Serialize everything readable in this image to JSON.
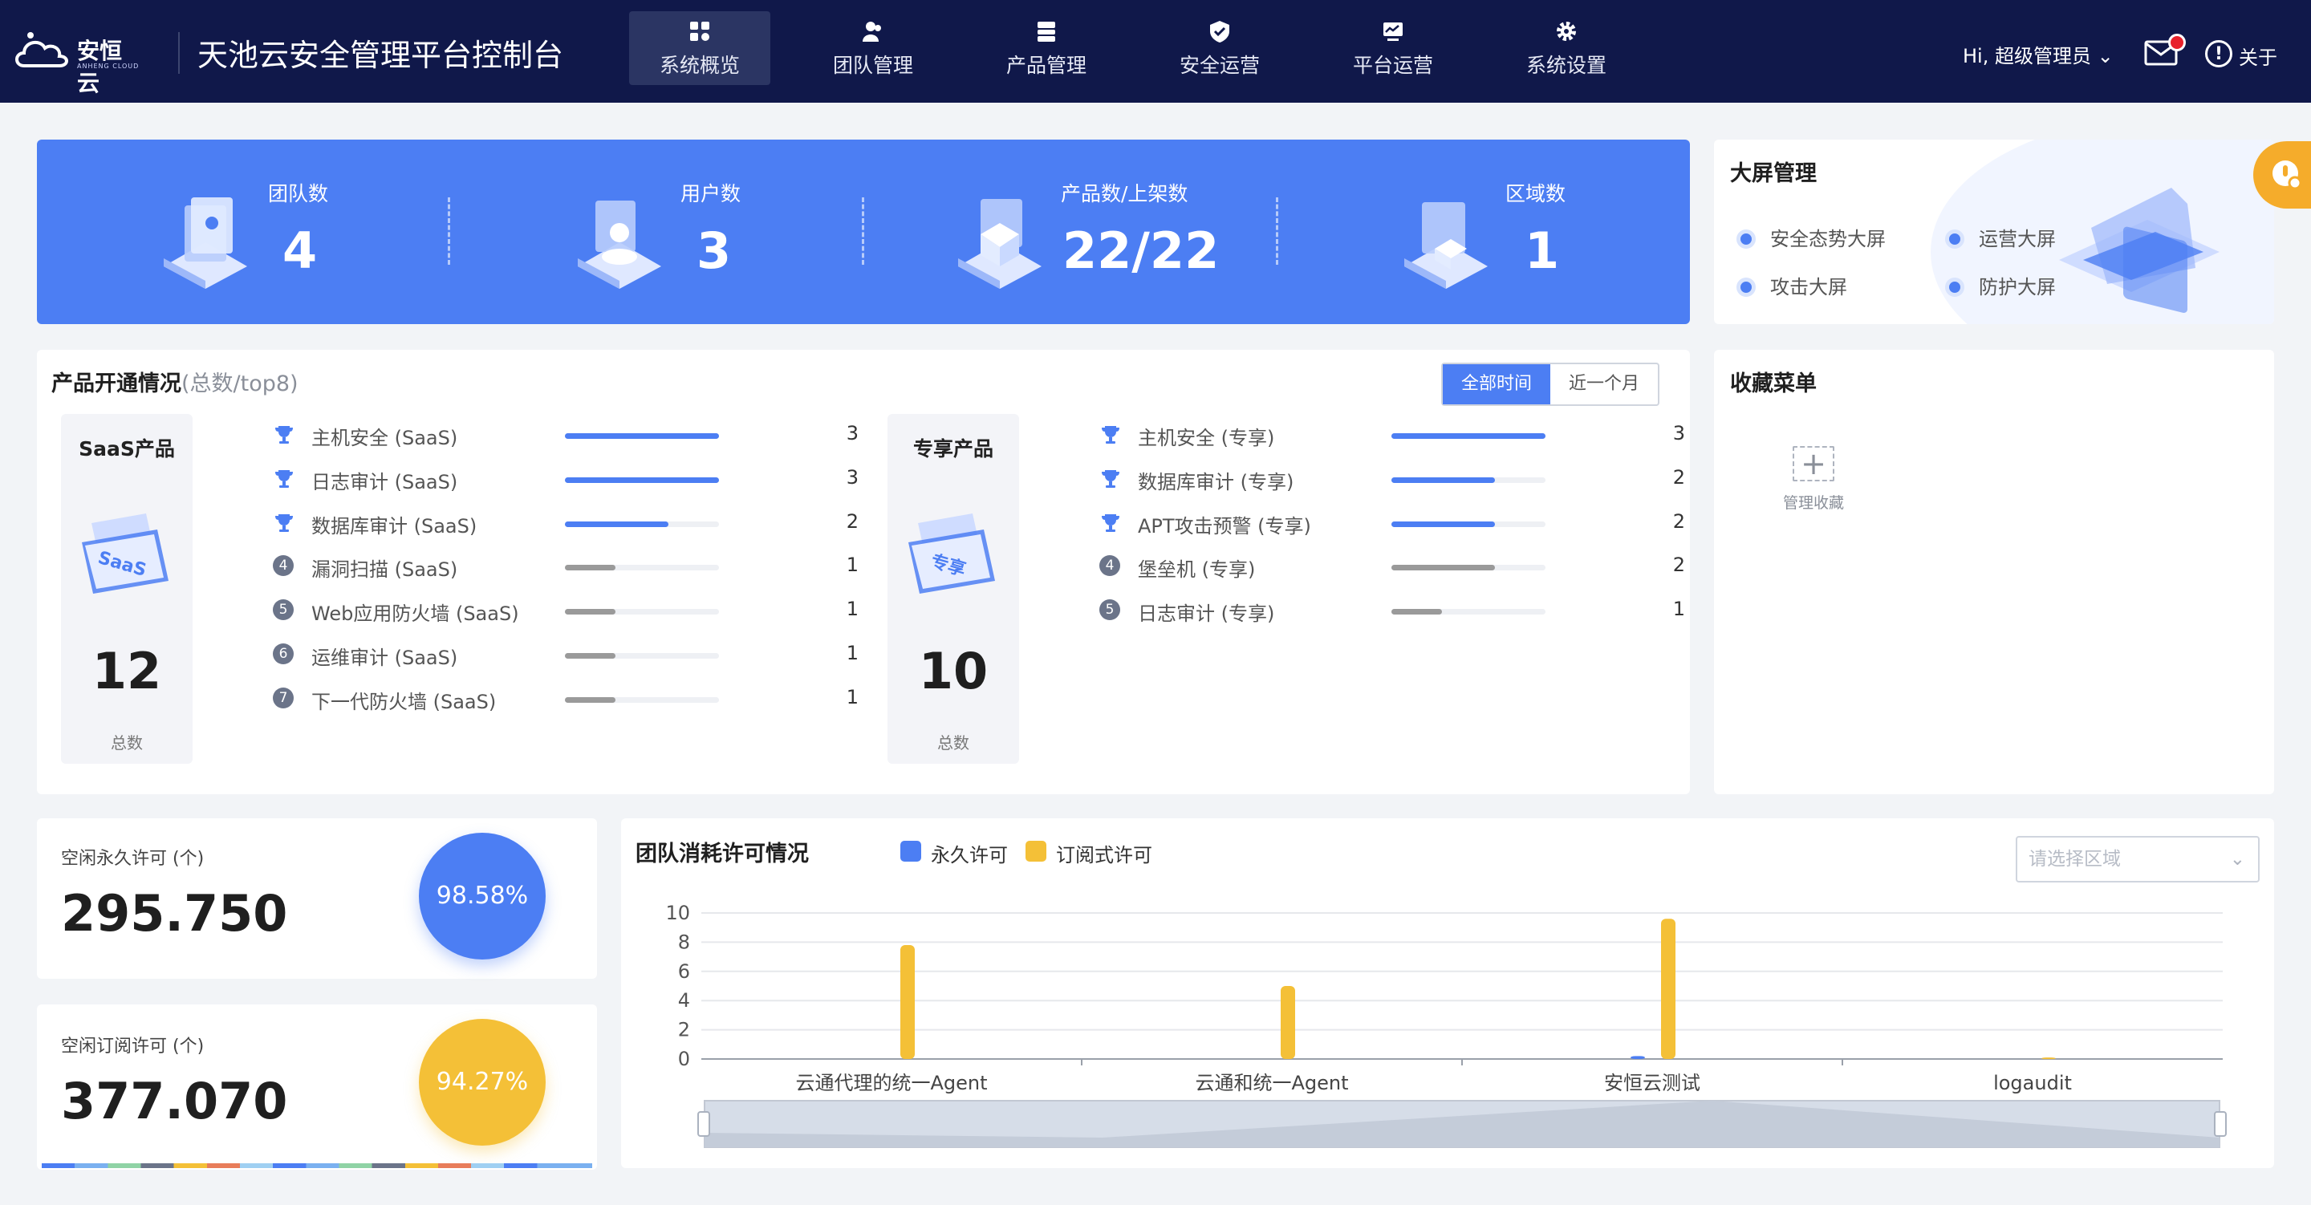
{
  "app": {
    "logo_text": "安恒云",
    "logo_sub": "ANHENG CLOUD",
    "title": "天池云安全管理平台控制台"
  },
  "nav": [
    {
      "label": "系统概览",
      "icon": "grid-icon",
      "active": true
    },
    {
      "label": "团队管理",
      "icon": "team-icon",
      "active": false
    },
    {
      "label": "产品管理",
      "icon": "product-icon",
      "active": false
    },
    {
      "label": "安全运营",
      "icon": "shield-icon",
      "active": false
    },
    {
      "label": "平台运营",
      "icon": "monitor-icon",
      "active": false
    },
    {
      "label": "系统设置",
      "icon": "gear-icon",
      "active": false
    }
  ],
  "user": {
    "greeting": "Hi, 超级管理员",
    "about": "关于"
  },
  "stats": [
    {
      "label": "团队数",
      "value": "4"
    },
    {
      "label": "用户数",
      "value": "3"
    },
    {
      "label": "产品数/上架数",
      "value": "22/22"
    },
    {
      "label": "区域数",
      "value": "1"
    }
  ],
  "bigscreen": {
    "title": "大屏管理",
    "items": [
      "安全态势大屏",
      "运营大屏",
      "攻击大屏",
      "防护大屏"
    ]
  },
  "products": {
    "title": "产品开通情况",
    "subtitle": "(总数/top8)",
    "tabs": [
      "全部时间",
      "近一个月"
    ],
    "active_tab": 0,
    "saas": {
      "title": "SaaS产品",
      "icon_label": "SaaS",
      "total": "12",
      "total_label": "总数",
      "ranking": [
        {
          "name": "主机安全 (SaaS)",
          "count": "3",
          "ratio": 1.0
        },
        {
          "name": "日志审计 (SaaS)",
          "count": "3",
          "ratio": 1.0
        },
        {
          "name": "数据库审计 (SaaS)",
          "count": "2",
          "ratio": 0.67
        },
        {
          "name": "漏洞扫描 (SaaS)",
          "count": "1",
          "ratio": 0.33
        },
        {
          "name": "Web应用防火墙 (SaaS)",
          "count": "1",
          "ratio": 0.33
        },
        {
          "name": "运维审计 (SaaS)",
          "count": "1",
          "ratio": 0.33
        },
        {
          "name": "下一代防火墙 (SaaS)",
          "count": "1",
          "ratio": 0.33
        }
      ]
    },
    "exclusive": {
      "title": "专享产品",
      "icon_label": "专享",
      "total": "10",
      "total_label": "总数",
      "ranking": [
        {
          "name": "主机安全 (专享)",
          "count": "3",
          "ratio": 1.0
        },
        {
          "name": "数据库审计 (专享)",
          "count": "2",
          "ratio": 0.67
        },
        {
          "name": "APT攻击预警 (专享)",
          "count": "2",
          "ratio": 0.67
        },
        {
          "name": "堡垒机 (专享)",
          "count": "2",
          "ratio": 0.67
        },
        {
          "name": "日志审计 (专享)",
          "count": "1",
          "ratio": 0.33
        }
      ]
    }
  },
  "favorites": {
    "title": "收藏菜单",
    "manage_label": "管理收藏"
  },
  "licenses": [
    {
      "label": "空闲永久许可 (个)",
      "value": "295.750",
      "percent": "98.58%",
      "color": "#4c7ef3"
    },
    {
      "label": "空闲订阅许可 (个)",
      "value": "377.070",
      "percent": "94.27%",
      "color": "#f4c037"
    }
  ],
  "license_chart": {
    "title": "团队消耗许可情况",
    "select_placeholder": "请选择区域",
    "chart_data": {
      "type": "bar",
      "title": "团队消耗许可情况",
      "categories": [
        "云通代理的统一Agent",
        "云通和统一Agent",
        "安恒云测试",
        "logaudit"
      ],
      "series": [
        {
          "name": "永久许可",
          "color": "#4c7ef3",
          "values": [
            0,
            0,
            0.2,
            0
          ]
        },
        {
          "name": "订阅式许可",
          "color": "#f4c037",
          "values": [
            7.8,
            5,
            9.6,
            0.1
          ]
        }
      ],
      "yticks": [
        0,
        2,
        4,
        6,
        8,
        10
      ],
      "ylim": [
        0,
        10
      ],
      "legend": "top",
      "grid": true
    }
  }
}
